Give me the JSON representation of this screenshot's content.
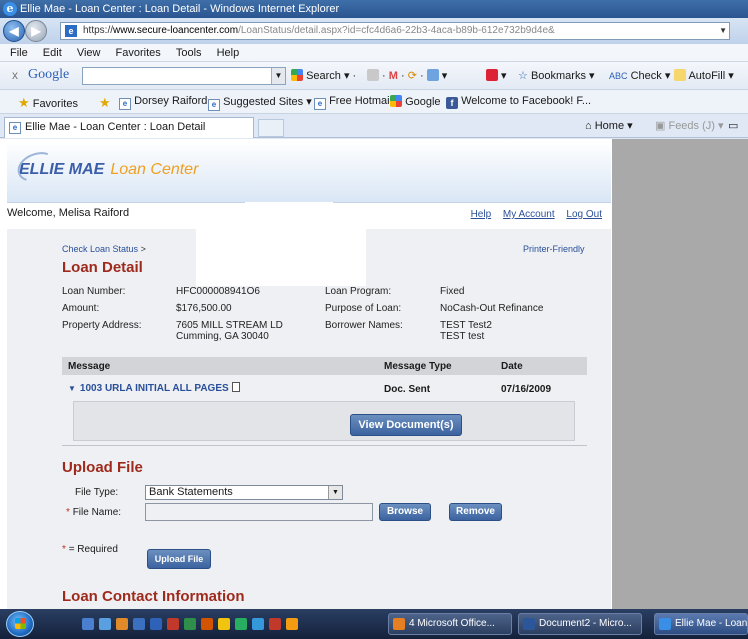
{
  "window": {
    "title": "Ellie Mae - Loan Center : Loan Detail - Windows Internet Explorer"
  },
  "address_bar": {
    "protocol": "https://",
    "domain": "www.secure-loancenter.com",
    "path": "/LoanStatus/detail.aspx?id=cfc4d6a6-22b3-4aca-b89b-612e732b9d4e&"
  },
  "menu": [
    "File",
    "Edit",
    "View",
    "Favorites",
    "Tools",
    "Help"
  ],
  "google_toolbar": {
    "close": "x",
    "logo": "Google",
    "search": "Search",
    "bookmarks": "Bookmarks",
    "check": "Check",
    "autofill": "AutoFill"
  },
  "favorites_bar": {
    "favorites": "Favorites",
    "items": [
      "Dorsey Raiford",
      "Suggested Sites ▾",
      "Free Hotmail",
      "Google",
      "Welcome to Facebook! F..."
    ]
  },
  "tab": {
    "label": "Ellie Mae - Loan Center : Loan Detail",
    "home": "Home",
    "feeds": "Feeds (J)"
  },
  "header": {
    "logo_main": "ELLIE MAE",
    "logo_sub": "Loan Center",
    "welcome": "Welcome, Melisa Raiford",
    "links": [
      "Help",
      "My Account",
      "Log Out"
    ]
  },
  "breadcrumb": {
    "label": "Check Loan Status",
    "separator": ">"
  },
  "printer_friendly": "Printer-Friendly",
  "loan_detail": {
    "title": "Loan Detail",
    "loan_number_label": "Loan Number:",
    "loan_number": "HFC000008941O6",
    "amount_label": "Amount:",
    "amount": "$176,500.00",
    "property_label": "Property Address:",
    "property_line1": "7605 MILL STREAM LD",
    "property_line2": "Cumming, GA 30040",
    "program_label": "Loan Program:",
    "program": "Fixed",
    "purpose_label": "Purpose of Loan:",
    "purpose": "NoCash-Out Refinance",
    "borrowers_label": "Borrower Names:",
    "borrower1": "TEST Test2",
    "borrower2": "TEST test"
  },
  "messages": {
    "col_message": "Message",
    "col_type": "Message Type",
    "col_date": "Date",
    "rows": [
      {
        "message": "1003 URLA INITIAL ALL PAGES",
        "type": "Doc. Sent",
        "date": "07/16/2009"
      }
    ],
    "view_button": "View Document(s)"
  },
  "upload": {
    "title": "Upload File",
    "file_type_label": "File Type:",
    "file_type_value": "Bank Statements",
    "file_name_label": "File Name:",
    "required_marker": "*",
    "browse": "Browse",
    "remove": "Remove",
    "required_note": "= Required",
    "upload_button": "Upload File"
  },
  "contact": {
    "title": "Loan Contact Information"
  },
  "taskbar": {
    "tasks": [
      "4 Microsoft Office...",
      "Document2 - Micro...",
      "Ellie Mae - Loan..."
    ]
  }
}
